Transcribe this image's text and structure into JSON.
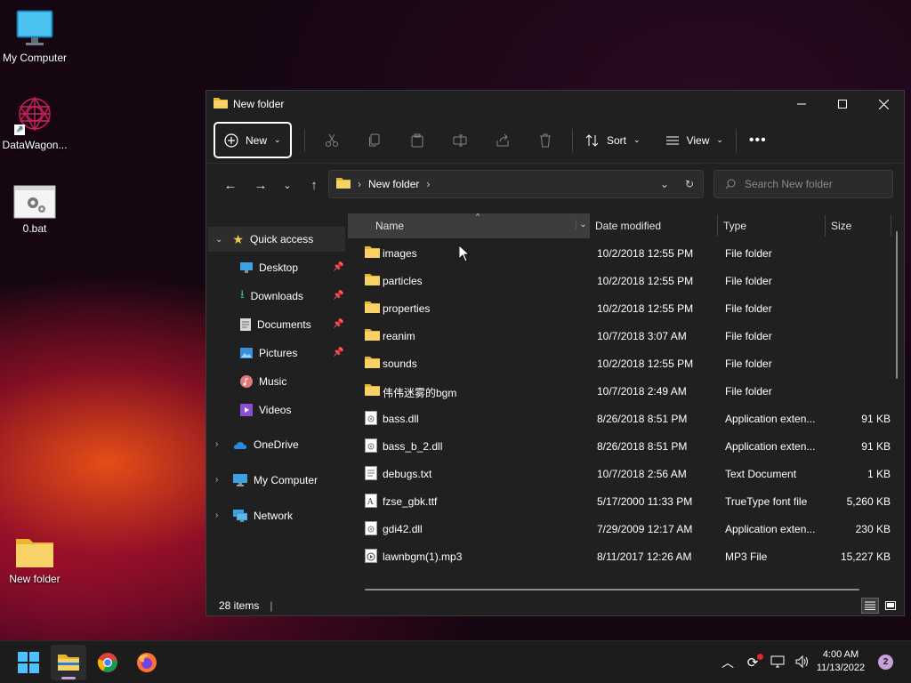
{
  "desktop": {
    "icons": [
      {
        "label": "My Computer"
      },
      {
        "label": "DataWagon..."
      },
      {
        "label": "0.bat"
      },
      {
        "label": "New folder"
      }
    ]
  },
  "window": {
    "title": "New folder",
    "toolbar": {
      "new_label": "New",
      "sort_label": "Sort",
      "view_label": "View"
    },
    "address": {
      "path_label": "New folder",
      "search_placeholder": "Search New folder"
    },
    "navpane": {
      "quick_access": "Quick access",
      "items": [
        {
          "label": "Desktop",
          "pinned": true
        },
        {
          "label": "Downloads",
          "pinned": true
        },
        {
          "label": "Documents",
          "pinned": true
        },
        {
          "label": "Pictures",
          "pinned": true
        },
        {
          "label": "Music",
          "pinned": false
        },
        {
          "label": "Videos",
          "pinned": false
        }
      ],
      "roots": [
        {
          "label": "OneDrive"
        },
        {
          "label": "My Computer"
        },
        {
          "label": "Network"
        }
      ]
    },
    "columns": {
      "name": "Name",
      "date": "Date modified",
      "type": "Type",
      "size": "Size"
    },
    "files": [
      {
        "name": "images",
        "date": "10/2/2018 12:55 PM",
        "type": "File folder",
        "size": "",
        "icon": "folder"
      },
      {
        "name": "particles",
        "date": "10/2/2018 12:55 PM",
        "type": "File folder",
        "size": "",
        "icon": "folder"
      },
      {
        "name": "properties",
        "date": "10/2/2018 12:55 PM",
        "type": "File folder",
        "size": "",
        "icon": "folder"
      },
      {
        "name": "reanim",
        "date": "10/7/2018 3:07 AM",
        "type": "File folder",
        "size": "",
        "icon": "folder"
      },
      {
        "name": "sounds",
        "date": "10/2/2018 12:55 PM",
        "type": "File folder",
        "size": "",
        "icon": "folder"
      },
      {
        "name": "伟伟迷雾的bgm",
        "date": "10/7/2018 2:49 AM",
        "type": "File folder",
        "size": "",
        "icon": "folder"
      },
      {
        "name": "bass.dll",
        "date": "8/26/2018 8:51 PM",
        "type": "Application exten...",
        "size": "91 KB",
        "icon": "dll"
      },
      {
        "name": "bass_b_2.dll",
        "date": "8/26/2018 8:51 PM",
        "type": "Application exten...",
        "size": "91 KB",
        "icon": "dll"
      },
      {
        "name": "debugs.txt",
        "date": "10/7/2018 2:56 AM",
        "type": "Text Document",
        "size": "1 KB",
        "icon": "txt"
      },
      {
        "name": "fzse_gbk.ttf",
        "date": "5/17/2000 11:33 PM",
        "type": "TrueType font file",
        "size": "5,260 KB",
        "icon": "font"
      },
      {
        "name": "gdi42.dll",
        "date": "7/29/2009 12:17 AM",
        "type": "Application exten...",
        "size": "230 KB",
        "icon": "dll"
      },
      {
        "name": "lawnbgm(1).mp3",
        "date": "8/11/2017 12:26 AM",
        "type": "MP3 File",
        "size": "15,227 KB",
        "icon": "mp3"
      }
    ],
    "status": {
      "item_count": "28 items"
    }
  },
  "taskbar": {
    "time": "4:00 AM",
    "date": "11/13/2022",
    "notification_count": "2"
  }
}
